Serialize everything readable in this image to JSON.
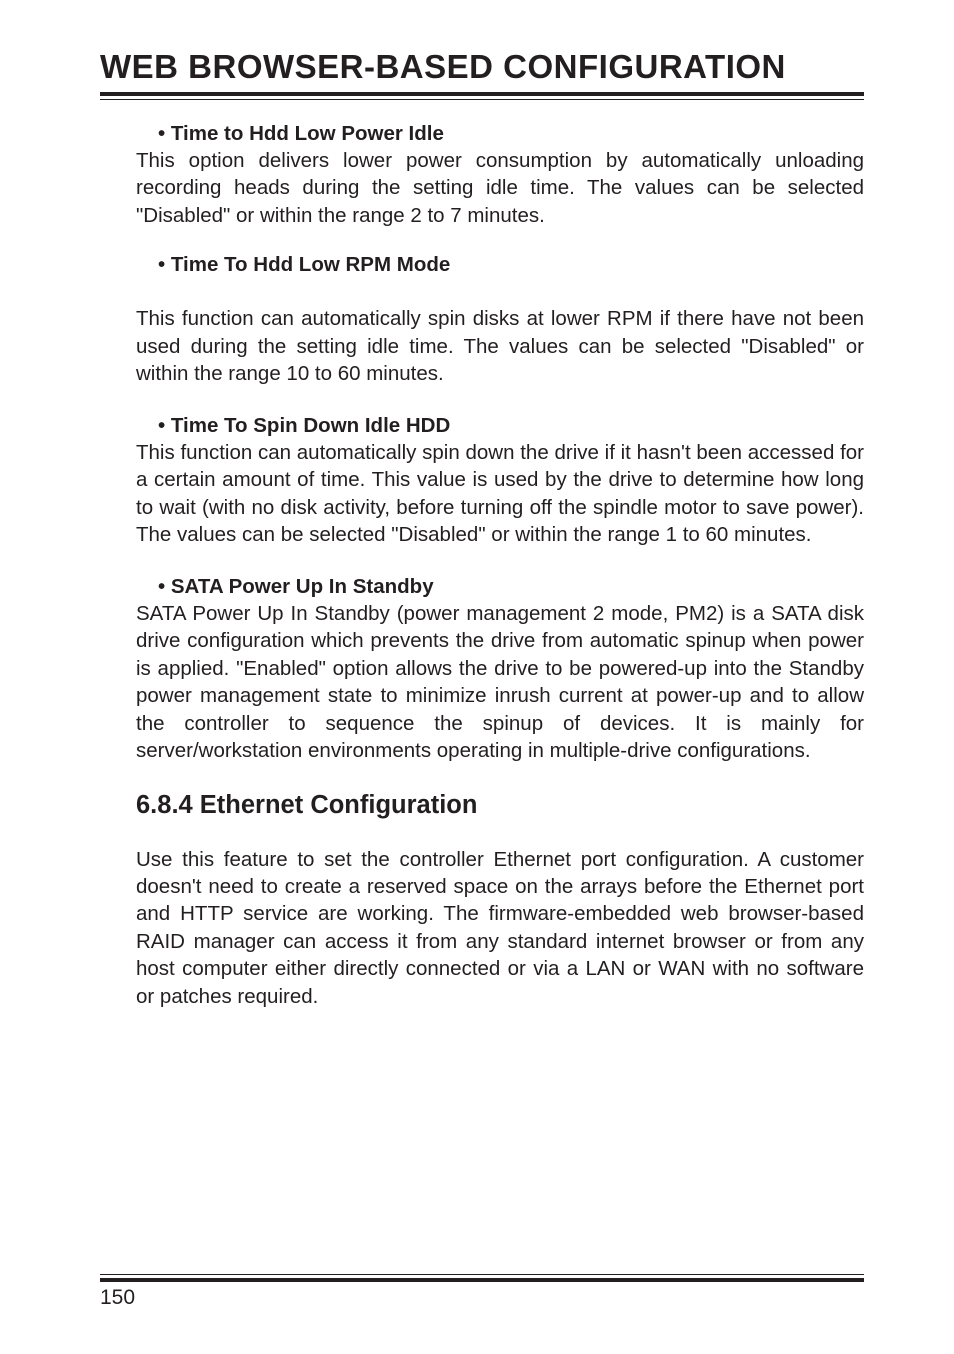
{
  "header": {
    "title": "WEB BROWSER-BASED CONFIGURATION"
  },
  "sections": {
    "item1": {
      "heading": "• Time to Hdd Low Power Idle",
      "body": "This option delivers lower power consumption by automatically unloading recording heads during the setting idle time. The values can be selected \"Disabled\" or within the range 2 to 7 minutes."
    },
    "item2": {
      "heading": "• Time To Hdd Low RPM Mode",
      "body": "This function can automatically spin disks at lower RPM if there have not been used during the setting idle time. The values can be selected \"Disabled\" or within the range 10 to 60 minutes."
    },
    "item3": {
      "heading": "• Time To Spin Down Idle HDD",
      "body": "This function can automatically spin down the drive if it hasn't been accessed for a certain amount of time. This value is used by the drive to determine how long to wait (with no disk activity, before turning off the spindle motor to save power). The values can be selected \"Disabled\" or within the range 1 to 60 minutes."
    },
    "item4": {
      "heading": "• SATA Power Up In Standby",
      "body": "SATA Power Up In Standby (power management 2 mode, PM2) is a SATA disk drive configuration which prevents the drive from automatic spinup when power is applied. \"Enabled\" option allows the drive to be powered-up into the Standby power management state to minimize inrush current at power-up and to allow the controller to sequence the spinup of devices. It is mainly for server/workstation environments operating in multiple-drive configurations."
    },
    "ethernet": {
      "heading": "6.8.4 Ethernet Configuration",
      "body": "Use this feature to set the controller Ethernet port configuration. A customer doesn't need to create a reserved space on the arrays before the Ethernet port and HTTP service are working. The firmware-embedded web browser-based RAID manager can access it from any standard internet browser or from any host computer either directly connected or via a LAN or WAN with no software or patches required."
    }
  },
  "footer": {
    "page": "150"
  }
}
